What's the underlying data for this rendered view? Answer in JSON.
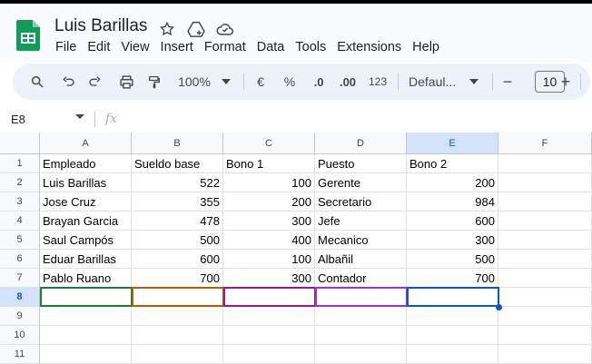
{
  "app": {
    "title": "Luis Barillas",
    "menu": [
      "File",
      "Edit",
      "View",
      "Insert",
      "Format",
      "Data",
      "Tools",
      "Extensions",
      "Help"
    ]
  },
  "toolbar": {
    "zoom": "100%",
    "currency": "€",
    "percent": "%",
    "dec_decrease": ".0",
    "dec_increase": ".00",
    "number_format": "123",
    "font": "Defaul...",
    "font_size": "10",
    "minus": "−",
    "plus": "+"
  },
  "formula_bar": {
    "cell_ref": "E8",
    "fx": "fx"
  },
  "sheet": {
    "columns": [
      "A",
      "B",
      "C",
      "D",
      "E",
      "F"
    ],
    "rows": [
      "1",
      "2",
      "3",
      "4",
      "5",
      "6",
      "7",
      "8",
      "9",
      "10",
      "11"
    ],
    "selected_column": "E",
    "selected_row": "8",
    "data": [
      [
        "Empleado",
        "Sueldo base",
        "Bono 1",
        "Puesto",
        "Bono 2"
      ],
      [
        "Luis Barillas",
        "522",
        "100",
        "Gerente",
        "200"
      ],
      [
        "Jose Cruz",
        "355",
        "200",
        "Secretario",
        "984"
      ],
      [
        "Brayan Garcia",
        "478",
        "300",
        "Jefe",
        "600"
      ],
      [
        "Saul Campós",
        "500",
        "400",
        "Mecanico",
        "300"
      ],
      [
        "Eduar Barillas",
        "600",
        "100",
        "Albañil",
        "500"
      ],
      [
        "Pablo Ruano",
        "700",
        "300",
        "Contador",
        "700"
      ]
    ],
    "highlight_colors": [
      "#1e7e34",
      "#b06000",
      "#a0188a",
      "#9334e6",
      "#0b57d0"
    ]
  }
}
